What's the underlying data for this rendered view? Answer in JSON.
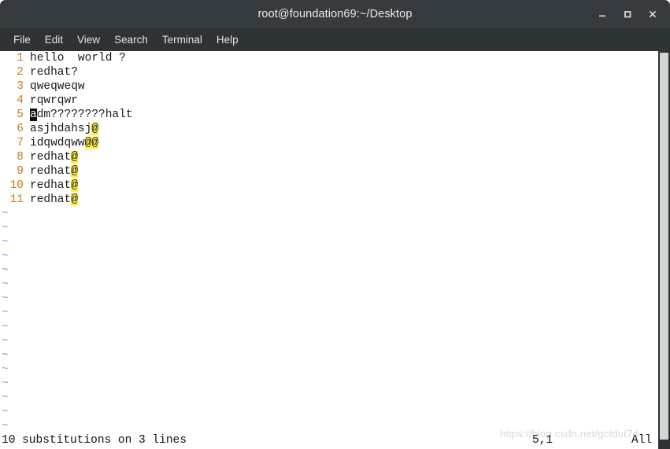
{
  "window": {
    "title": "root@foundation69:~/Desktop",
    "controls": [
      {
        "name": "minimize-button",
        "label": "–",
        "icon": "minimize-icon"
      },
      {
        "name": "maximize-button",
        "label": "□",
        "icon": "maximize-icon"
      },
      {
        "name": "close-button",
        "label": "✕",
        "icon": "close-icon"
      }
    ]
  },
  "menubar": {
    "items": [
      {
        "label": "File"
      },
      {
        "label": "Edit"
      },
      {
        "label": "View"
      },
      {
        "label": "Search"
      },
      {
        "label": "Terminal"
      },
      {
        "label": "Help"
      }
    ]
  },
  "editor": {
    "lines": [
      {
        "num": "1",
        "segments": [
          {
            "text": "hello  world ?",
            "style": "plain"
          }
        ]
      },
      {
        "num": "2",
        "segments": [
          {
            "text": "redhat?",
            "style": "plain"
          }
        ]
      },
      {
        "num": "3",
        "segments": [
          {
            "text": "qweqweqw",
            "style": "plain"
          }
        ]
      },
      {
        "num": "4",
        "segments": [
          {
            "text": "rqwrqwr",
            "style": "plain"
          }
        ]
      },
      {
        "num": "5",
        "segments": [
          {
            "text": "a",
            "style": "cursor"
          },
          {
            "text": "dm????????halt",
            "style": "plain"
          }
        ]
      },
      {
        "num": "6",
        "segments": [
          {
            "text": "asjhdahsj",
            "style": "plain"
          },
          {
            "text": "@",
            "style": "hl"
          }
        ]
      },
      {
        "num": "7",
        "segments": [
          {
            "text": "idqwdqww",
            "style": "plain"
          },
          {
            "text": "@@",
            "style": "hl"
          }
        ]
      },
      {
        "num": "8",
        "segments": [
          {
            "text": "redhat",
            "style": "plain"
          },
          {
            "text": "@",
            "style": "hl"
          }
        ]
      },
      {
        "num": "9",
        "segments": [
          {
            "text": "redhat",
            "style": "plain"
          },
          {
            "text": "@",
            "style": "hl"
          }
        ]
      },
      {
        "num": "10",
        "segments": [
          {
            "text": "redhat",
            "style": "plain"
          },
          {
            "text": "@",
            "style": "hl"
          }
        ]
      },
      {
        "num": "11",
        "segments": [
          {
            "text": "redhat",
            "style": "plain"
          },
          {
            "text": "@",
            "style": "hl"
          }
        ]
      }
    ],
    "empty_marker": "~",
    "empty_marker_count": 16,
    "colors": {
      "line_number": "#c97b1d",
      "empty_marker": "#7aa5d2",
      "search_highlight": "#fff04a",
      "cursor": "#0d0d0d",
      "text": "#1a1a1a",
      "background": "#ffffff"
    }
  },
  "statusline": {
    "message": "10 substitutions on 3 lines",
    "position": "5,1",
    "scroll": "All"
  },
  "scrollbar": {
    "name": "vertical-scrollbar"
  },
  "watermark": {
    "text": "https://blog.csdn.net/gctdut7d"
  }
}
